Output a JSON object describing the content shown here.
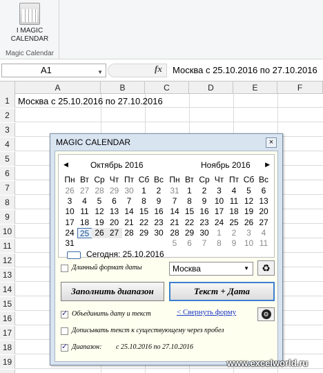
{
  "ribbon": {
    "button_line1": "I MAGIC",
    "button_line2": "CALENDAR",
    "group_label": "Magic Calendar"
  },
  "formula_bar": {
    "name_box": "A1",
    "fx": "fx",
    "formula": "Москва с 25.10.2016 по 27.10.2016"
  },
  "columns": [
    "A",
    "B",
    "C",
    "D",
    "E",
    "F"
  ],
  "rows": [
    "1",
    "2",
    "3",
    "4",
    "5",
    "6",
    "7",
    "8",
    "9",
    "10",
    "11",
    "12",
    "13",
    "14",
    "15",
    "16",
    "17",
    "18",
    "19",
    "20"
  ],
  "cell_a1": "Москва с 25.10.2016 по 27.10.2016",
  "dialog": {
    "title": "MAGIC CALENDAR",
    "close": "×",
    "weekdays": [
      "Пн",
      "Вт",
      "Ср",
      "Чт",
      "Пт",
      "Сб",
      "Вс"
    ],
    "month1": {
      "title": "Октябрь 2016",
      "weeks": [
        [
          "26",
          "27",
          "28",
          "29",
          "30",
          "1",
          "2"
        ],
        [
          "3",
          "4",
          "5",
          "6",
          "7",
          "8",
          "9"
        ],
        [
          "10",
          "11",
          "12",
          "13",
          "14",
          "15",
          "16"
        ],
        [
          "17",
          "18",
          "19",
          "20",
          "21",
          "22",
          "23"
        ],
        [
          "24",
          "25",
          "26",
          "27",
          "28",
          "29",
          "30"
        ],
        [
          "31",
          "",
          "",
          "",
          "",
          "",
          ""
        ]
      ]
    },
    "month2": {
      "title": "Ноябрь 2016",
      "weeks": [
        [
          "31",
          "1",
          "2",
          "3",
          "4",
          "5",
          "6"
        ],
        [
          "7",
          "8",
          "9",
          "10",
          "11",
          "12",
          "13"
        ],
        [
          "14",
          "15",
          "16",
          "17",
          "18",
          "19",
          "20"
        ],
        [
          "21",
          "22",
          "23",
          "24",
          "25",
          "26",
          "27"
        ],
        [
          "28",
          "29",
          "30",
          "1",
          "2",
          "3",
          "4"
        ],
        [
          "5",
          "6",
          "7",
          "8",
          "9",
          "10",
          "11"
        ]
      ]
    },
    "today_label": "Сегодня: 25.10.2016",
    "long_format_label": "Длинный формат даты",
    "city_value": "Москва",
    "fill_range_button": "Заполнить диапазон",
    "text_date_button": "Текст + Дата",
    "merge_label": "Объединить дату и текст",
    "collapse_link": "< Свернуть форму",
    "append_label": "Дописывать текст к существующему через пробел",
    "range_label": "Диапазон:",
    "range_value": "с 25.10.2016 по 27.10.2016",
    "checks": {
      "long_format": false,
      "merge": true,
      "append": false,
      "range": true
    }
  },
  "watermark": "www.excelworld.ru"
}
